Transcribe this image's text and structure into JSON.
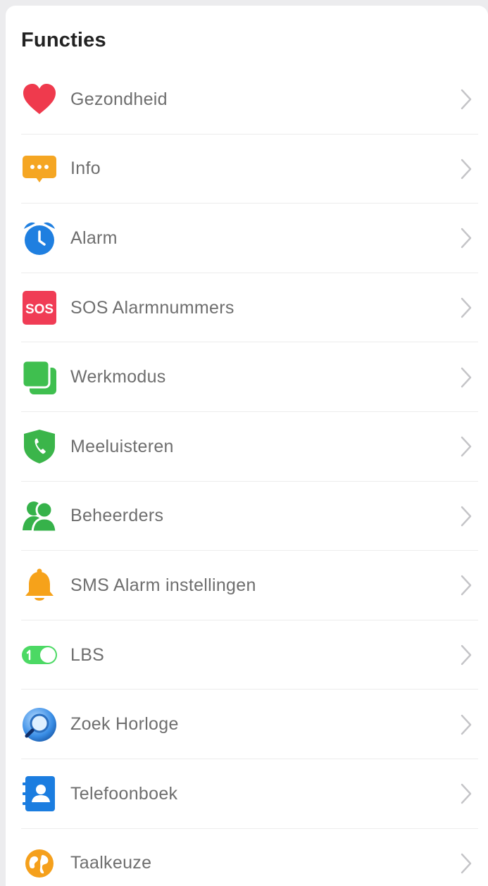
{
  "section": {
    "title": "Functies"
  },
  "items": [
    {
      "label": "Gezondheid",
      "icon": "heart-icon",
      "color": "#ef3a4d"
    },
    {
      "label": "Info",
      "icon": "chat-bubble-icon",
      "color": "#f5a623"
    },
    {
      "label": "Alarm",
      "icon": "alarm-clock-icon",
      "color": "#1f7fe0"
    },
    {
      "label": "SOS Alarmnummers",
      "icon": "sos-icon",
      "color": "#f03c55"
    },
    {
      "label": "Werkmodus",
      "icon": "work-mode-icon",
      "color": "#3fbf4f"
    },
    {
      "label": "Meeluisteren",
      "icon": "shield-phone-icon",
      "color": "#3bb54a"
    },
    {
      "label": "Beheerders",
      "icon": "people-icon",
      "color": "#36b24a"
    },
    {
      "label": "SMS Alarm instellingen",
      "icon": "bell-icon",
      "color": "#f6a21a"
    },
    {
      "label": "LBS",
      "icon": "toggle-icon",
      "color": "#4cd964"
    },
    {
      "label": "Zoek Horloge",
      "icon": "magnifier-icon",
      "color": "#3a8ee6"
    },
    {
      "label": "Telefoonboek",
      "icon": "contacts-book-icon",
      "color": "#1b7de0"
    },
    {
      "label": "Taalkeuze",
      "icon": "globe-icon",
      "color": "#f5a01c"
    }
  ],
  "sos_text": "SOS"
}
